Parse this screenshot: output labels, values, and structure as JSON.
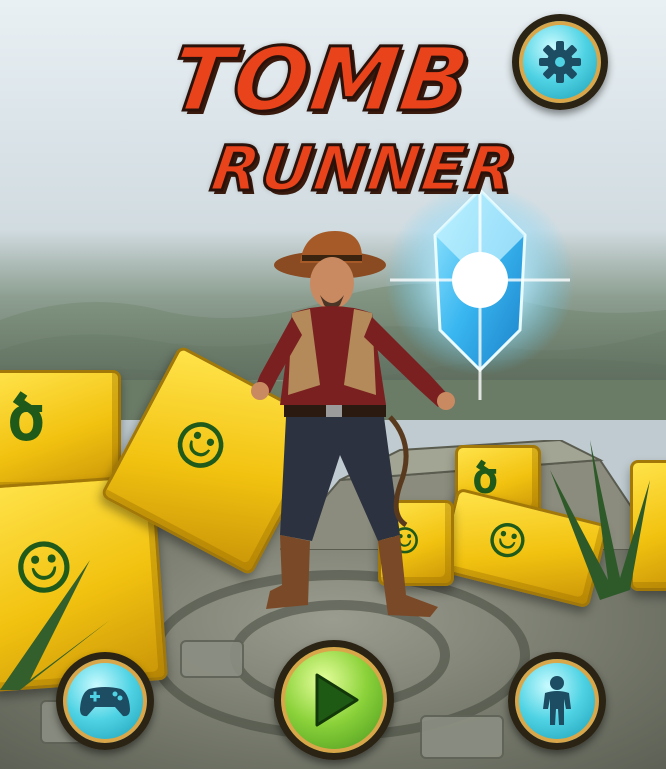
{
  "title": {
    "line1": "TOMB",
    "line2": "RUNNER"
  },
  "buttons": {
    "settings": {
      "icon": "gear-icon"
    },
    "play": {
      "icon": "play-icon"
    },
    "controller": {
      "icon": "gamepad-icon"
    },
    "character": {
      "icon": "person-icon"
    }
  },
  "colors": {
    "title_orange": "#e8431a",
    "title_outline": "#2a120a",
    "button_teal": "#4fd3e4",
    "button_green": "#8bd23a",
    "button_rim": "#d9a74a",
    "crystal_blue": "#5ad0ff",
    "block_gold": "#f2c210"
  }
}
